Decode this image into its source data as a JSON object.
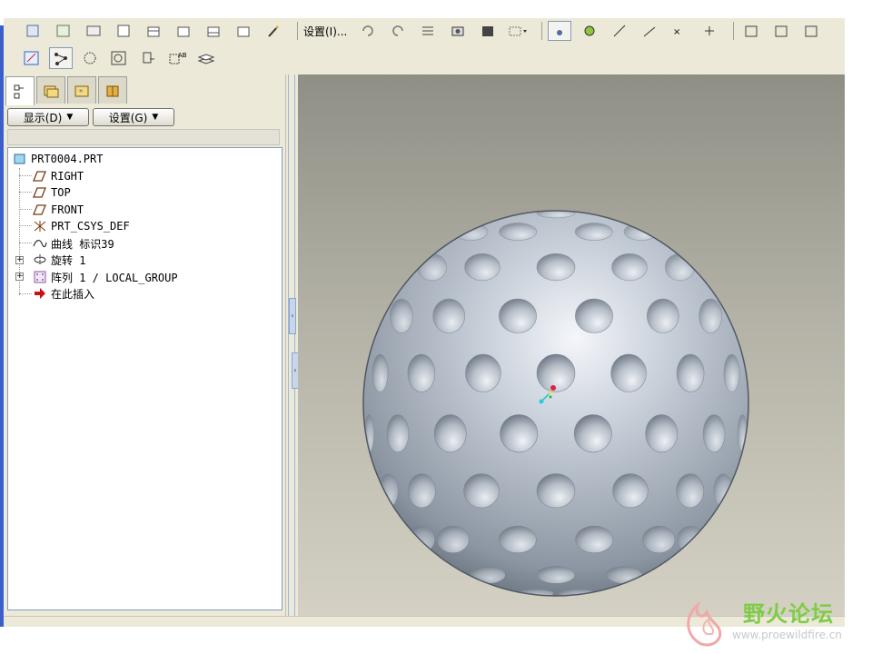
{
  "panel": {
    "display_button": "显示(D)",
    "settings_button": "设置(G)"
  },
  "toolbar": {
    "settings_menu": "设置(I)..."
  },
  "tree": {
    "items": [
      {
        "label": "PRT0004.PRT",
        "icon": "part-icon"
      },
      {
        "label": "RIGHT",
        "icon": "datum-plane-icon"
      },
      {
        "label": "TOP",
        "icon": "datum-plane-icon"
      },
      {
        "label": "FRONT",
        "icon": "datum-plane-icon"
      },
      {
        "label": "PRT_CSYS_DEF",
        "icon": "coordinate-system-icon"
      },
      {
        "label": "曲线 标识39",
        "icon": "curve-icon"
      },
      {
        "label": "旋转 1",
        "icon": "revolve-icon"
      },
      {
        "label": "阵列 1 / LOCAL_GROUP",
        "icon": "pattern-icon"
      },
      {
        "label": "在此插入",
        "icon": "insert-here-arrow-icon"
      }
    ]
  },
  "watermark": {
    "title": "野火论坛",
    "url": "www.proewildfire.cn"
  },
  "colors": {
    "accent_blue": "#3a5fcd",
    "panel_bg": "#ece9d8",
    "watermark_green": "#7fcc46",
    "insert_arrow_red": "#cc1010"
  }
}
